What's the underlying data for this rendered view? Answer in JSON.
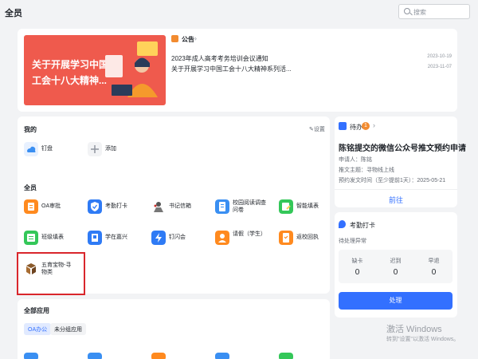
{
  "header": {
    "title": "全员",
    "search_placeholder": "搜索"
  },
  "notice": {
    "banner_line1": "关于开展学习中国",
    "banner_line2": "工会十八大精神...",
    "label": "公告",
    "items": [
      {
        "title": "2023年成人高考考务培训会议通知",
        "date": "2023-10-19"
      },
      {
        "title": "关于开展学习中国工会十八大精神系列活...",
        "date": "2023-11-07"
      }
    ]
  },
  "mine": {
    "heading": "我的",
    "settings": "设置",
    "apps": [
      {
        "name": "钉盘"
      },
      {
        "name": "添加"
      }
    ]
  },
  "all_staff": {
    "heading": "全员",
    "apps": [
      {
        "name": "OA审批"
      },
      {
        "name": "考勤打卡"
      },
      {
        "name": "书记信箱"
      },
      {
        "name": "校园阅读调查问卷"
      },
      {
        "name": "智能填表"
      },
      {
        "name": "班级填表"
      },
      {
        "name": "学在嘉兴"
      },
      {
        "name": "钉闪会"
      },
      {
        "name": "请假（学生）"
      },
      {
        "name": "返校回执"
      },
      {
        "name": "五育宝物-寻物类"
      }
    ]
  },
  "all_apps": {
    "heading": "全部应用",
    "tabs": [
      "OA办公",
      "未分组应用"
    ]
  },
  "todo": {
    "label": "待办",
    "badge": "1",
    "title": "陈铭提交的微信公众号推文预约申请",
    "applicant": "申请人：陈铭",
    "topic": "推文主题：寻物线上线",
    "planned": "预约发文时间（至少提前1天）：2025-05-21",
    "goto": "前往"
  },
  "attendance": {
    "label": "考勤打卡",
    "subtitle": "待处理异常",
    "stats": [
      {
        "label": "缺卡",
        "value": "0"
      },
      {
        "label": "迟到",
        "value": "0"
      },
      {
        "label": "早退",
        "value": "0"
      }
    ],
    "button": "处理"
  },
  "watermark": {
    "line1": "激活 Windows",
    "line2": "转到\"设置\"以激活 Windows。"
  },
  "colors": {
    "accent": "#3370ff",
    "highlight": "#d9262c",
    "banner": "#ef5a4d"
  }
}
